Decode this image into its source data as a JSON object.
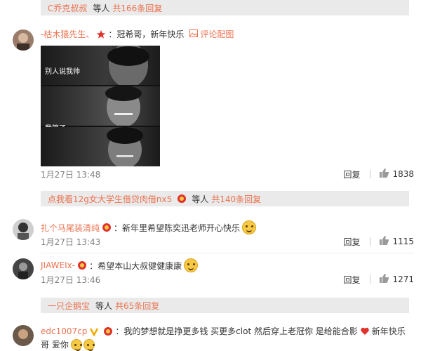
{
  "replies": [
    {
      "user": "C乔克叔叔",
      "mid": "等人",
      "count": "共166条回复"
    },
    {
      "user": "点我看12g女大学生借贷肉借nx5",
      "mid": "等人",
      "count": "共140条回复"
    },
    {
      "user": "一只企鹅宝",
      "mid": "等人",
      "count": "共65条回复"
    }
  ],
  "comments": [
    {
      "user": "-枯木猿先生、",
      "text": "：冠希哥，新年快乐",
      "image_link": "评论配图",
      "image_text": [
        "别人说我帅",
        "我笑了"
      ],
      "time": "1月27日 13:48",
      "reply": "回复",
      "likes": "1838"
    },
    {
      "user": "扎个马尾装清纯",
      "text": "：新年里希望陈奕迅老师开心快乐",
      "time": "1月27日 13:43",
      "reply": "回复",
      "likes": "1115"
    },
    {
      "user": "JIAWEIx-",
      "text": "：希望本山大叔健健康康",
      "time": "1月27日 13:46",
      "reply": "回复",
      "likes": "1271"
    },
    {
      "user": "edc1007cp",
      "text": "：我的梦想就是挣更多钱 买更多clot 然后穿上老冠你 是给能合影",
      "text_tail": "新年快乐",
      "line2": "哥 爱你"
    }
  ],
  "colors": {
    "accent": "#eb7350",
    "reply_bg": "#eaeaea",
    "text": "#333333",
    "meta": "#808080"
  }
}
